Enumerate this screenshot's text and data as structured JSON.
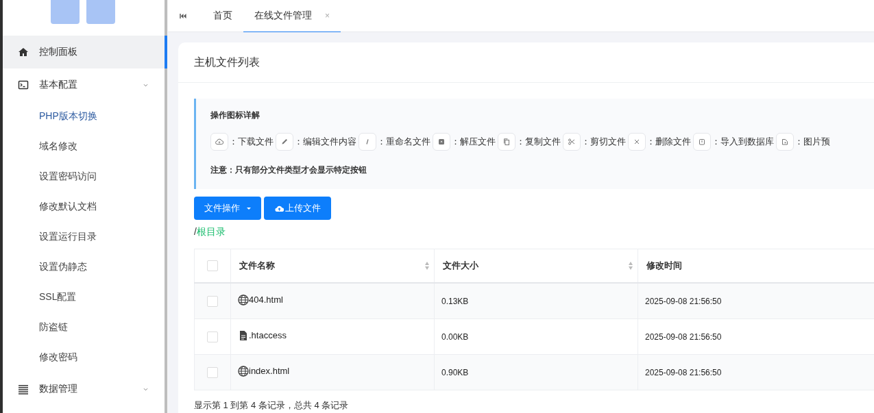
{
  "sidebar": {
    "items": [
      {
        "label": "控制面板",
        "kind": "home",
        "active": true,
        "collapsible": false
      },
      {
        "label": "基本配置",
        "kind": "terminal",
        "active": false,
        "collapsible": true,
        "children": [
          {
            "label": "PHP版本切换",
            "selected": true
          },
          {
            "label": "域名修改",
            "selected": false
          },
          {
            "label": "设置密码访问",
            "selected": false
          },
          {
            "label": "修改默认文档",
            "selected": false
          },
          {
            "label": "设置运行目录",
            "selected": false
          },
          {
            "label": "设置伪静态",
            "selected": false
          },
          {
            "label": "SSL配置",
            "selected": false
          },
          {
            "label": "防盗链",
            "selected": false
          },
          {
            "label": "修改密码",
            "selected": false
          }
        ]
      },
      {
        "label": "数据管理",
        "kind": "list",
        "active": false,
        "collapsible": true
      }
    ]
  },
  "tabs": [
    {
      "label": "首页",
      "selected": false,
      "closable": false
    },
    {
      "label": "在线文件管理",
      "selected": true,
      "closable": true,
      "close": "×"
    }
  ],
  "card": {
    "title": "主机文件列表",
    "legend": {
      "title": "操作图标详解",
      "items": [
        {
          "kind": "download",
          "label": "：下载文件"
        },
        {
          "kind": "edit",
          "label": "：编辑文件内容"
        },
        {
          "kind": "rename",
          "label": "：重命名文件"
        },
        {
          "kind": "extract",
          "label": "：解压文件"
        },
        {
          "kind": "copy",
          "label": "：复制文件"
        },
        {
          "kind": "cut",
          "label": "：剪切文件"
        },
        {
          "kind": "delete",
          "label": "：删除文件"
        },
        {
          "kind": "import",
          "label": "：导入到数据库"
        },
        {
          "kind": "image",
          "label": "：图片预"
        }
      ],
      "note": "注意：只有部分文件类型才会显示特定按钮"
    },
    "buttons": [
      {
        "label": "文件操作",
        "kind": "dropdown"
      },
      {
        "label": "上传文件",
        "kind": "upload"
      }
    ],
    "path": {
      "separator": "/",
      "label": "根目录"
    },
    "table": {
      "select_all": {
        "checked": false
      },
      "columns": [
        {
          "label": "文件名称",
          "sortable": true
        },
        {
          "label": "文件大小",
          "sortable": true
        },
        {
          "label": "修改时间"
        }
      ],
      "rows": [
        {
          "checked": false,
          "kind": "web",
          "name": "404.html",
          "size": "0.13KB",
          "time": "2025-09-08 21:56:50"
        },
        {
          "checked": false,
          "kind": "file",
          "name": ".htaccess",
          "size": "0.00KB",
          "time": "2025-09-08 21:56:50"
        },
        {
          "checked": false,
          "kind": "web",
          "name": "index.html",
          "size": "0.90KB",
          "time": "2025-09-08 21:56:50"
        }
      ]
    },
    "footer": "显示第 1 到第 4 条记录，总共 4 条记录"
  }
}
